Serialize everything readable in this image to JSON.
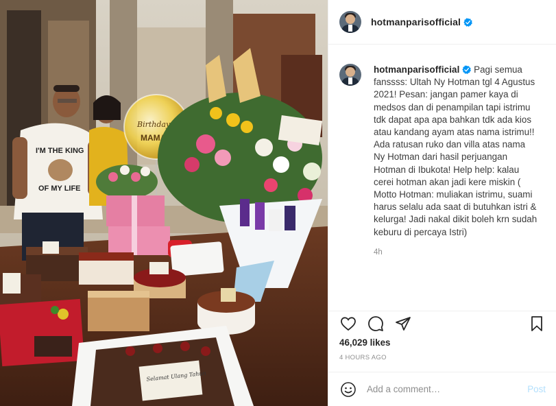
{
  "post": {
    "username": "hotmanparisofficial",
    "verified": true,
    "caption": "Pagi semua fanssss: Ultah Ny Hotman tgl 4 Agustus 2021! Pesan: jangan pamer kaya di medsos dan di penampilan tapi istrimu tdk dapat apa apa bahkan tdk ada kios atau kandang ayam atas nama istrimu!! Ada ratusan ruko dan villa atas nama Ny Hotman dari hasil perjuangan Hotman di Ibukota! Help help: kalau cerei hotman akan jadi kere miskin ( Motto Hotman: muliakan istrimu, suami harus selalu ada saat di butuhkan istri & kelurga! Jadi nakal dikit boleh krn sudah keburu di percaya Istri)",
    "caption_age": "4h",
    "likes": "46,029 likes",
    "timestamp": "4 HOURS AGO"
  },
  "comment": {
    "placeholder": "Add a comment…",
    "post_label": "Post"
  },
  "photo": {
    "shirt_text_1": "I'M THE KING",
    "shirt_text_2": "OF MY LIFE",
    "balloon_text_1": "Birthday",
    "balloon_text_2": "MAMA",
    "cake_plaque": "Selamat Ulang Tahun"
  },
  "icons": {
    "like": "heart-icon",
    "comment": "comment-icon",
    "share": "paper-plane-icon",
    "save": "bookmark-icon",
    "emoji": "smiley-icon",
    "verified": "verified-badge-icon"
  },
  "colors": {
    "verified_blue": "#0095f6",
    "post_disabled": "#b2dffc",
    "secondary_text": "#8e8e8e"
  }
}
